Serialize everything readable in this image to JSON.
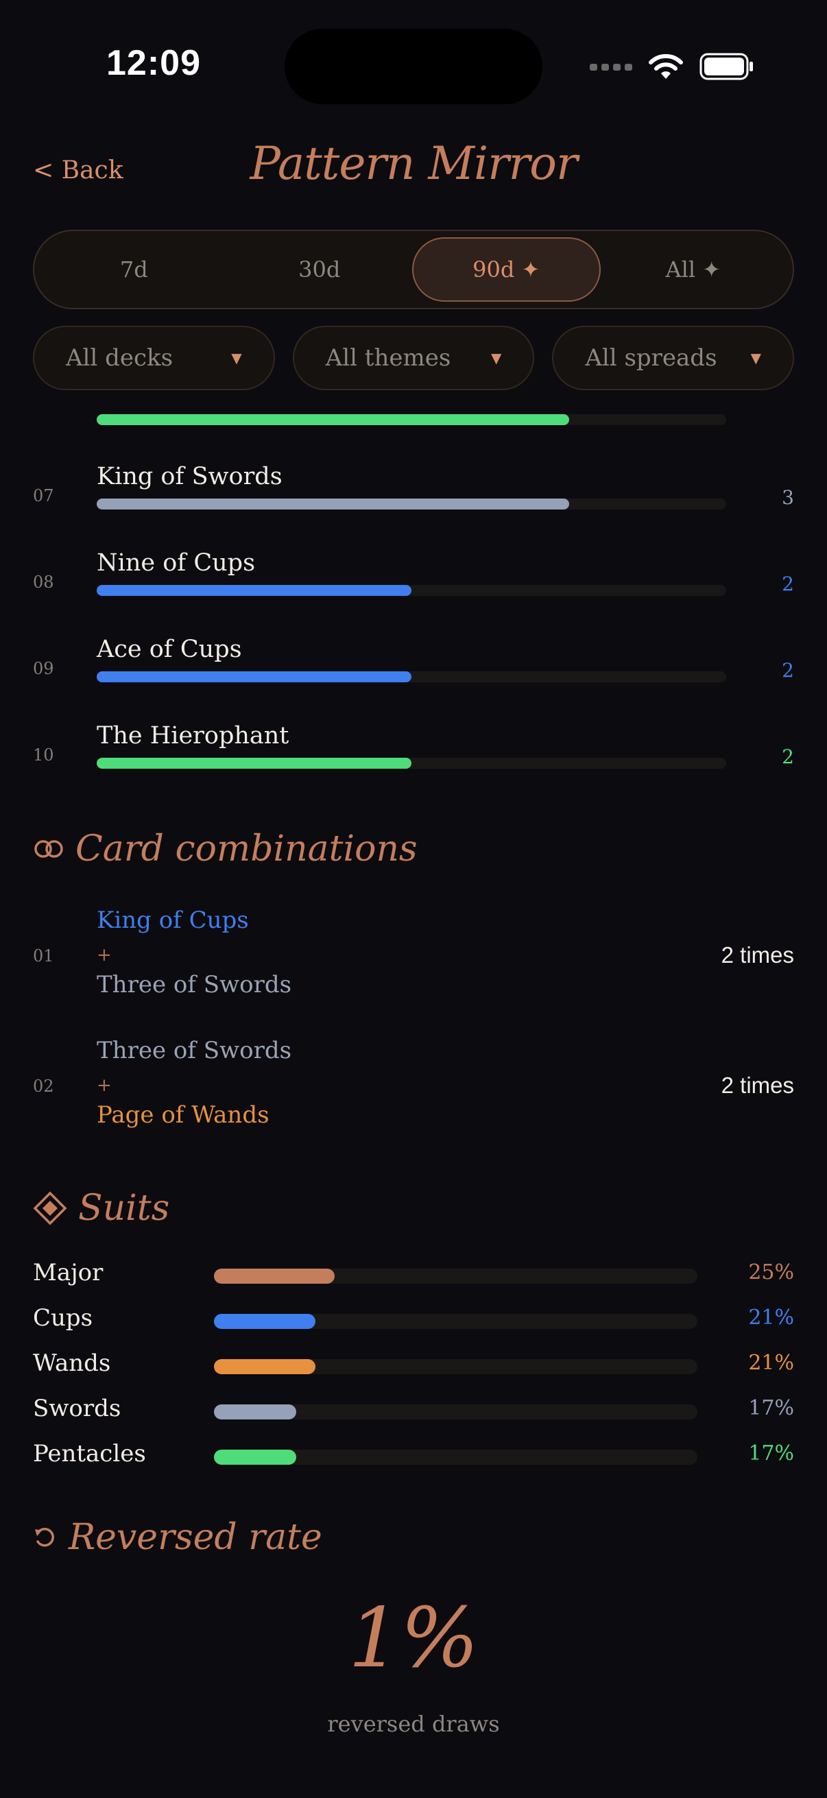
{
  "status": {
    "time": "12:09"
  },
  "nav": {
    "back": "< Back",
    "title": "Pattern Mirror"
  },
  "ranges": [
    {
      "label": "7d",
      "active": false
    },
    {
      "label": "30d",
      "active": false
    },
    {
      "label": "90d ✦",
      "active": true
    },
    {
      "label": "All ✦",
      "active": false
    }
  ],
  "filters": {
    "decks": "All decks",
    "themes": "All themes",
    "spreads": "All spreads",
    "caret": "▼"
  },
  "cards": [
    {
      "index": "07",
      "name": "King of Swords",
      "count": "3",
      "level": 0.75,
      "color": "#94a1b8"
    },
    {
      "index": "08",
      "name": "Nine of Cups",
      "count": "2",
      "level": 0.5,
      "color": "#3f7fef"
    },
    {
      "index": "09",
      "name": "Ace of Cups",
      "count": "2",
      "level": 0.5,
      "color": "#3f7fef"
    },
    {
      "index": "10",
      "name": "The Hierophant",
      "count": "2",
      "level": 0.5,
      "color": "#4fdc7a"
    }
  ],
  "partial_card": {
    "level": 0.75,
    "color": "#4fdc7a"
  },
  "combinations": {
    "heading": "Card combinations",
    "items": [
      {
        "index": "01",
        "card_a": "King of Cups",
        "color_a": "#3f7fef",
        "plus": "+",
        "card_b": "Three of Swords",
        "color_b": "#9aa4b5",
        "times": "2 times"
      },
      {
        "index": "02",
        "card_a": "Three of Swords",
        "color_a": "#9aa4b5",
        "plus": "+",
        "card_b": "Page of Wands",
        "color_b": "#e8913e",
        "times": "2 times"
      }
    ]
  },
  "suits": {
    "heading": "Suits",
    "items": [
      {
        "label": "Major",
        "pct": "25%",
        "level": 0.25,
        "color": "#c57e5c"
      },
      {
        "label": "Cups",
        "pct": "21%",
        "level": 0.21,
        "color": "#3f7fef"
      },
      {
        "label": "Wands",
        "pct": "21%",
        "level": 0.21,
        "color": "#e8913e"
      },
      {
        "label": "Swords",
        "pct": "17%",
        "level": 0.17,
        "color": "#94a1b8"
      },
      {
        "label": "Pentacles",
        "pct": "17%",
        "level": 0.17,
        "color": "#4fdc7a"
      }
    ]
  },
  "reversed": {
    "heading": "Reversed rate",
    "value": "1%",
    "caption": "reversed draws"
  }
}
